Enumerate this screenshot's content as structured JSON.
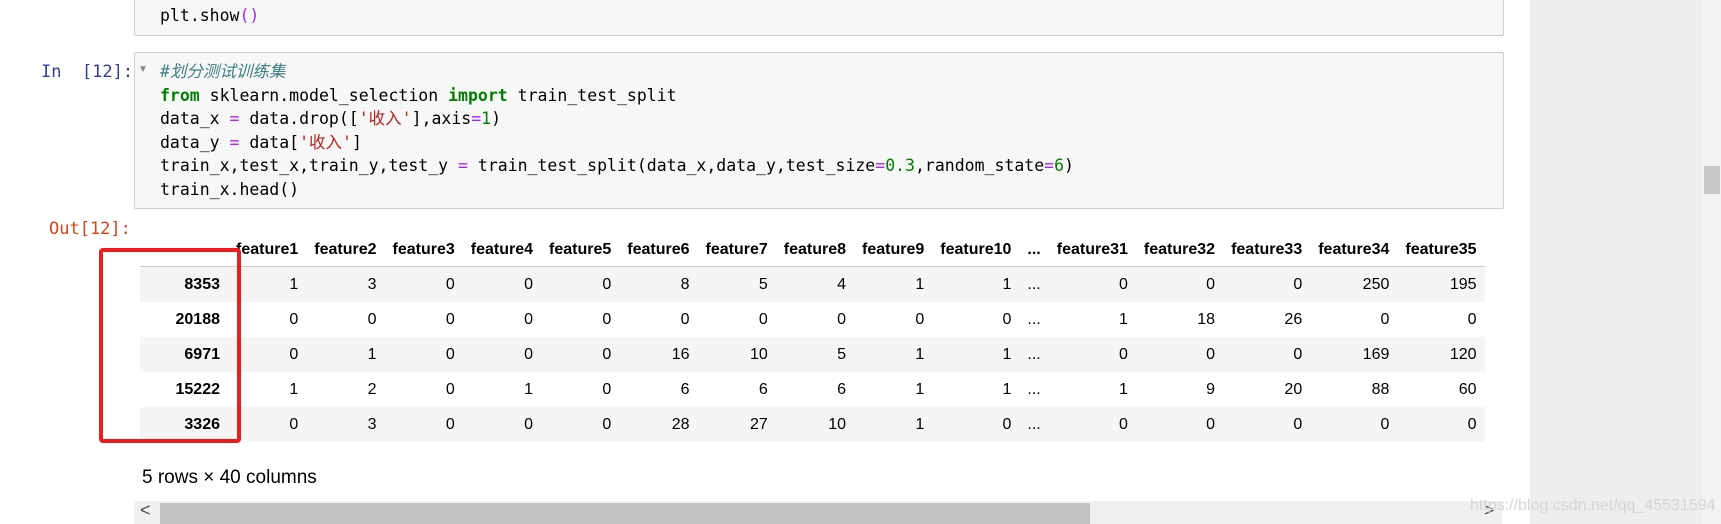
{
  "prev_cell": {
    "code_parts": [
      [
        "",
        "plt"
      ],
      [
        "",
        ".show"
      ],
      [
        "op",
        "()"
      ]
    ]
  },
  "cell": {
    "in_prompt": "In  [12]:",
    "out_prompt": "Out[12]:",
    "collapse_icon": "triangle-down-icon",
    "code_lines": [
      [
        [
          "cmt",
          "#划分测试训练集"
        ]
      ],
      [
        [
          "kw",
          "from"
        ],
        [
          "",
          " sklearn.model_selection "
        ],
        [
          "kw",
          "import"
        ],
        [
          "",
          " train_test_split"
        ]
      ],
      [
        [
          "",
          "data_x "
        ],
        [
          "op",
          "="
        ],
        [
          "",
          " data.drop(["
        ],
        [
          "str",
          "'收入'"
        ],
        [
          "",
          "],axis"
        ],
        [
          "op",
          "="
        ],
        [
          "num",
          "1"
        ],
        [
          "",
          ")"
        ]
      ],
      [
        [
          "",
          "data_y "
        ],
        [
          "op",
          "="
        ],
        [
          "",
          " data["
        ],
        [
          "str",
          "'收入'"
        ],
        [
          "",
          "]"
        ]
      ],
      [
        [
          "",
          "train_x,test_x,train_y,test_y "
        ],
        [
          "op",
          "="
        ],
        [
          "",
          " train_test_split(data_x,data_y,test_size"
        ],
        [
          "op",
          "="
        ],
        [
          "num",
          "0.3"
        ],
        [
          "",
          ",random_state"
        ],
        [
          "op",
          "="
        ],
        [
          "num",
          "6"
        ],
        [
          "",
          ")"
        ]
      ],
      [
        [
          "",
          "train_x.head()"
        ]
      ]
    ]
  },
  "dataframe": {
    "columns": [
      "",
      "feature1",
      "feature2",
      "feature3",
      "feature4",
      "feature5",
      "feature6",
      "feature7",
      "feature8",
      "feature9",
      "feature10",
      "...",
      "feature31",
      "feature32",
      "feature33",
      "feature34",
      "feature35"
    ],
    "rows": [
      [
        "8353",
        "1",
        "3",
        "0",
        "0",
        "0",
        "8",
        "5",
        "4",
        "1",
        "1",
        "...",
        "0",
        "0",
        "0",
        "250",
        "195"
      ],
      [
        "20188",
        "0",
        "0",
        "0",
        "0",
        "0",
        "0",
        "0",
        "0",
        "0",
        "0",
        "...",
        "1",
        "18",
        "26",
        "0",
        "0"
      ],
      [
        "6971",
        "0",
        "1",
        "0",
        "0",
        "0",
        "16",
        "10",
        "5",
        "1",
        "1",
        "...",
        "0",
        "0",
        "0",
        "169",
        "120"
      ],
      [
        "15222",
        "1",
        "2",
        "0",
        "1",
        "0",
        "6",
        "6",
        "6",
        "1",
        "1",
        "...",
        "1",
        "9",
        "20",
        "88",
        "60"
      ],
      [
        "3326",
        "0",
        "3",
        "0",
        "0",
        "0",
        "28",
        "27",
        "10",
        "1",
        "0",
        "...",
        "0",
        "0",
        "0",
        "0",
        "0"
      ]
    ],
    "shape_text": "5 rows × 40 columns"
  },
  "scrollbar": {
    "left_arrow": "<",
    "right_arrow": ">"
  },
  "watermark": "https://blog.csdn.net/qq_45531594",
  "colors": {
    "highlight_box": "#ee1c1c",
    "in_prompt": "#303f9f",
    "out_prompt": "#d84315"
  }
}
